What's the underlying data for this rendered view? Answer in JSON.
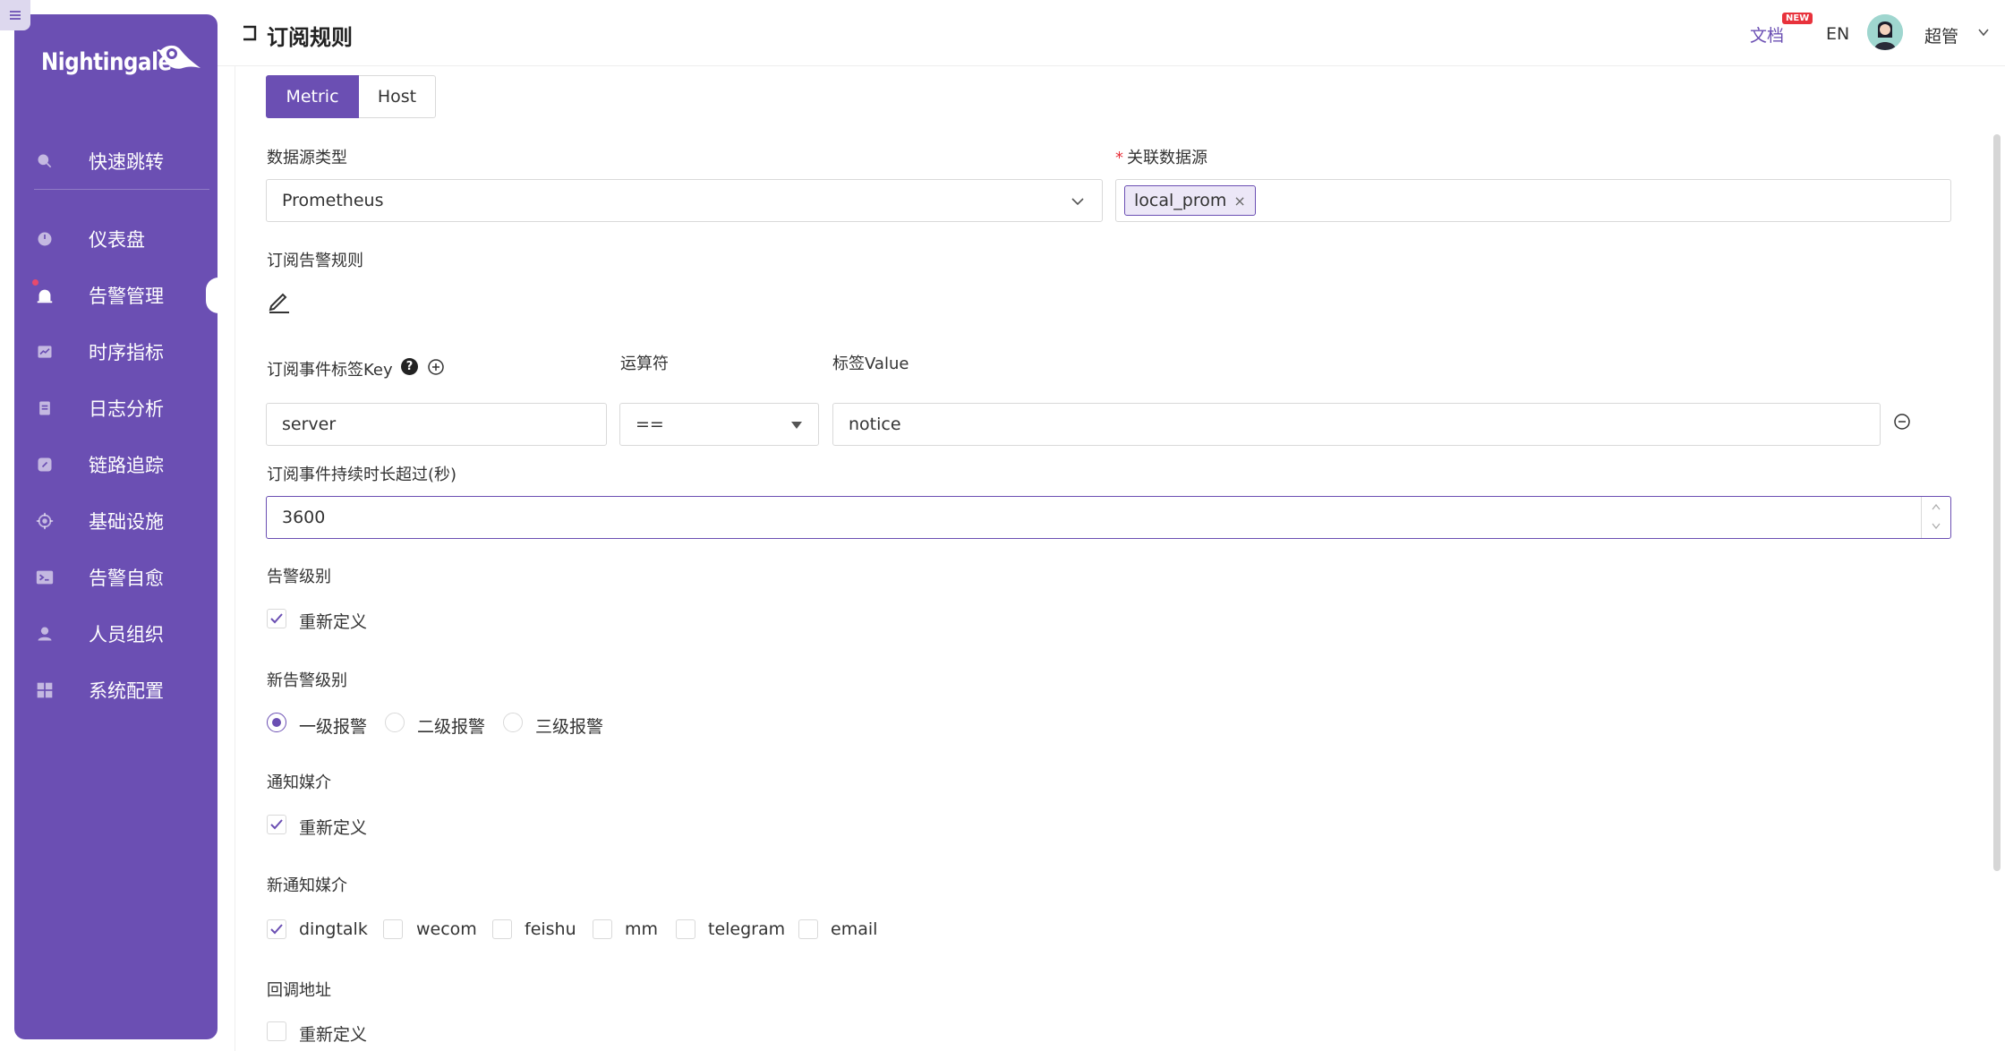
{
  "brand": {
    "name": "Nightingale"
  },
  "sidebar": {
    "items": [
      {
        "label": "快速跳转",
        "icon": "search-icon"
      },
      {
        "label": "仪表盘",
        "icon": "dashboard-icon"
      },
      {
        "label": "告警管理",
        "icon": "alarm-icon",
        "active": true
      },
      {
        "label": "时序指标",
        "icon": "chart-icon"
      },
      {
        "label": "日志分析",
        "icon": "log-icon"
      },
      {
        "label": "链路追踪",
        "icon": "link-icon"
      },
      {
        "label": "基础设施",
        "icon": "target-icon"
      },
      {
        "label": "告警自愈",
        "icon": "terminal-icon"
      },
      {
        "label": "人员组织",
        "icon": "user-icon"
      },
      {
        "label": "系统配置",
        "icon": "grid-icon"
      }
    ]
  },
  "header": {
    "title": "订阅规则",
    "doc_label": "文档",
    "new_badge": "NEW",
    "lang": "EN",
    "user_name": "超管"
  },
  "form": {
    "tabs": [
      "Metric",
      "Host"
    ],
    "datasource_type_label": "数据源类型",
    "datasource_type_value": "Prometheus",
    "related_datasource_label": "关联数据源",
    "related_datasource_tag": "local_prom",
    "subscribe_rule_label": "订阅告警规则",
    "tag_key_label": "订阅事件标签Key",
    "operator_label": "运算符",
    "tag_value_label": "标签Value",
    "tag_key_value": "server",
    "operator_value": "==",
    "tag_value_value": "notice",
    "duration_label": "订阅事件持续时长超过(秒)",
    "duration_value": "3600",
    "severity_label": "告警级别",
    "severity_redefine": "重新定义",
    "new_severity_label": "新告警级别",
    "severity_options": [
      "一级报警",
      "二级报警",
      "三级报警"
    ],
    "notify_media_label": "通知媒介",
    "notify_media_redefine": "重新定义",
    "new_notify_media_label": "新通知媒介",
    "media_options": [
      "dingtalk",
      "wecom",
      "feishu",
      "mm",
      "telegram",
      "email"
    ],
    "callback_label": "回调地址",
    "callback_redefine": "重新定义"
  },
  "colors": {
    "accent": "#6b4fb3",
    "danger": "#e8323c"
  }
}
